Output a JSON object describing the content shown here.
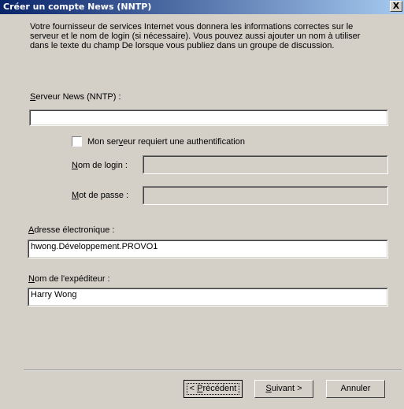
{
  "window": {
    "title": "Créer un compte News (NNTP)",
    "close_label": "X"
  },
  "intro": "Votre fournisseur de services Internet vous donnera les informations correctes sur le serveur et le nom de login (si nécessaire). Vous pouvez aussi ajouter un nom à utiliser dans le texte du champ De lorsque vous publiez dans un groupe de discussion.",
  "server": {
    "label_key": "S",
    "label_rest": "erveur News (NNTP) :",
    "value": ""
  },
  "auth": {
    "label_pre": "Mon ser",
    "label_key": "v",
    "label_post": "eur requiert une authentification",
    "checked": false
  },
  "login": {
    "label_key": "N",
    "label_rest": "om de login :",
    "value": ""
  },
  "password": {
    "label_key": "M",
    "label_rest": "ot de passe :",
    "value": ""
  },
  "email": {
    "label_key": "A",
    "label_rest": "dresse électronique :",
    "value": "hwong.Développement.PROVO1"
  },
  "sender": {
    "label_key": "N",
    "label_rest": "om de l'expéditeur :",
    "value": "Harry Wong"
  },
  "buttons": {
    "prev_pre": "< ",
    "prev_key": "P",
    "prev_rest": "récédent",
    "next_key": "S",
    "next_rest": "uivant >",
    "cancel": "Annuler"
  }
}
